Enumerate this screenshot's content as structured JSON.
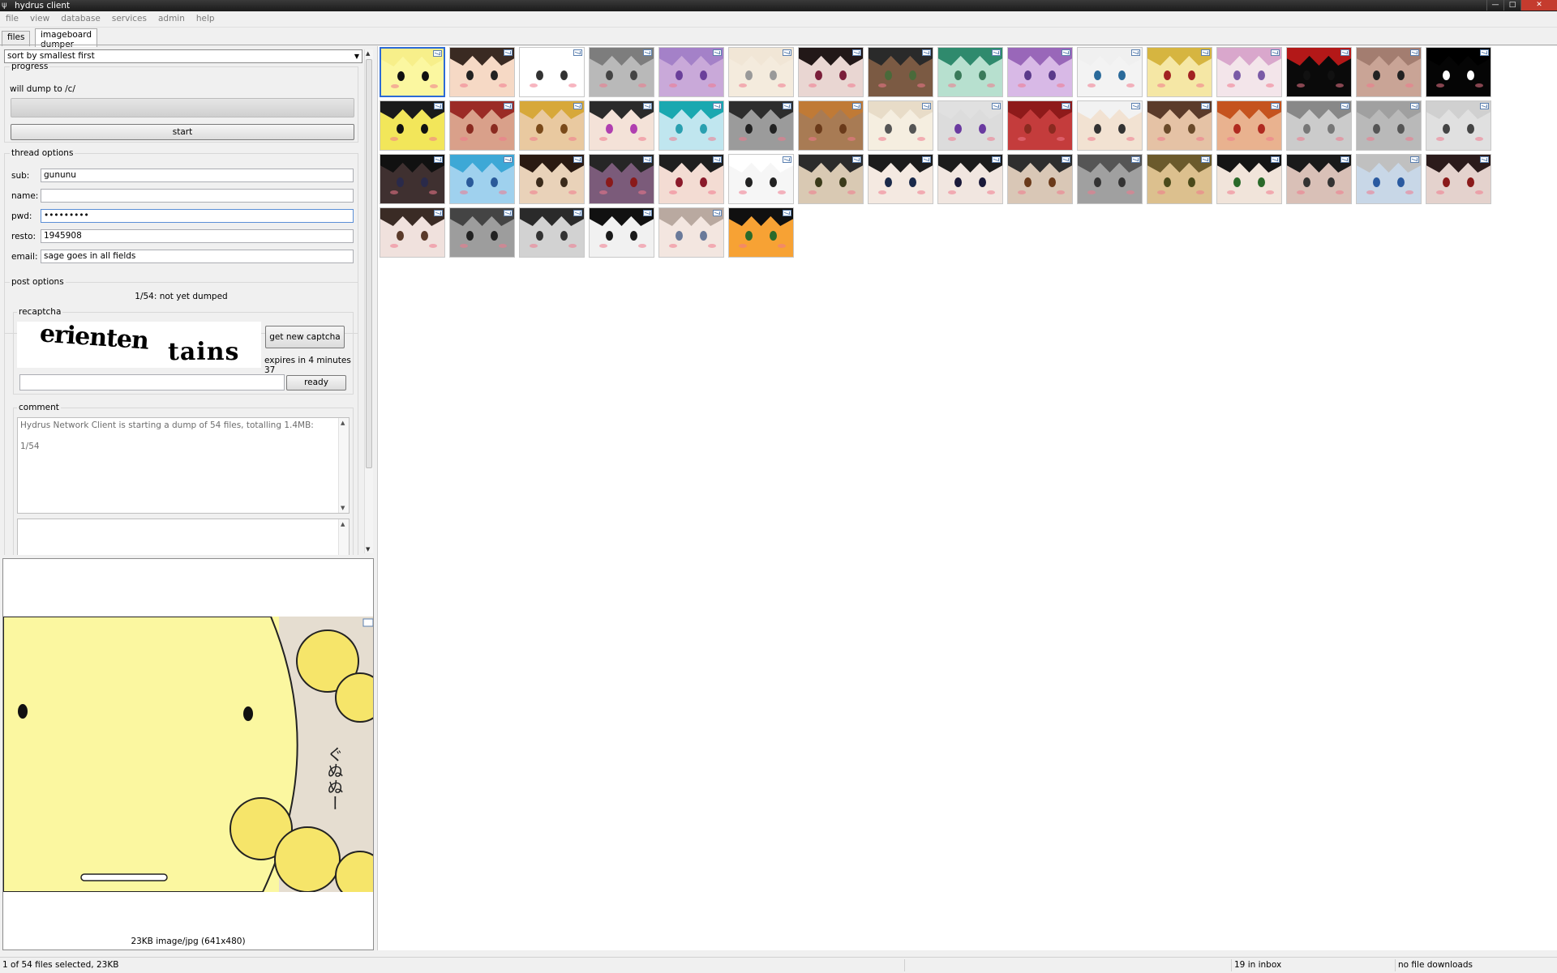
{
  "window": {
    "title": "hydrus client"
  },
  "menu": [
    "file",
    "view",
    "database",
    "services",
    "admin",
    "help"
  ],
  "tabs": [
    {
      "label": "files",
      "active": false
    },
    {
      "label": "imageboard dumper",
      "active": true
    }
  ],
  "sort": {
    "selected": "sort by smallest first"
  },
  "progress": {
    "title": "progress",
    "dump_target": "will dump to /c/",
    "value": 0,
    "start_label": "start"
  },
  "thread_options": {
    "title": "thread options",
    "fields": [
      {
        "label": "sub:",
        "value": "gununu"
      },
      {
        "label": "name:",
        "value": ""
      },
      {
        "label": "pwd:",
        "value": "•••••••••"
      },
      {
        "label": "resto:",
        "value": "1945908"
      },
      {
        "label": "email:",
        "value": "sage goes in all fields"
      }
    ]
  },
  "post_options": {
    "title": "post options",
    "status": "1/54: not yet dumped",
    "recaptcha": {
      "title": "recaptcha",
      "word1": "erienten",
      "word2": "tains",
      "new_captcha_label": "get new captcha",
      "expires": "expires in 4 minutes 37",
      "ready_label": "ready",
      "answer": ""
    },
    "comment": {
      "title": "comment",
      "line1": "Hydrus Network Client is starting a dump of 54 files, totalling 1.4MB:",
      "line2": "1/54"
    }
  },
  "preview": {
    "caption": "23KB image/jpg (641x480)",
    "vertical_text": "ぐぬぬー"
  },
  "thumbnails": {
    "count": 54,
    "selected_index": 0,
    "colors": [
      "#fbf7a0",
      "#f6d9c5",
      "#ffffff",
      "#b9b9b9",
      "#c9a9d9",
      "#f4ebdd",
      "#e9d6d2",
      "#7b5a43",
      "#b7e0cf",
      "#d8b9e6",
      "#f3f3f3",
      "#f5e7a5",
      "#f3e5ea",
      "#0a0a0a",
      "#c9a496",
      "#050505",
      "#f2e65a",
      "#d9a08a",
      "#e9c9a0",
      "#f4e2d8",
      "#c0e6ef",
      "#9b9b9b",
      "#a87b54",
      "#f5eee0",
      "#dcdcdc",
      "#c43c3c",
      "#f2e2d2",
      "#e5c2a5",
      "#e9b28f",
      "#cbcbcb",
      "#b9b9b9",
      "#e0e0e0",
      "#3f3030",
      "#9fd1ee",
      "#e9d2b9",
      "#7b5b7a",
      "#f3dcd3",
      "#f6f6f6",
      "#d9c9b3",
      "#f4e9e1",
      "#f1e6e0",
      "#d9c7b6",
      "#a0a0a0",
      "#dcc08e",
      "#f1e4da",
      "#d9c0b7",
      "#c8d7e7",
      "#e4d2cd",
      "#f0e1dd",
      "#9d9d9d",
      "#d2d2d2",
      "#f1f1f1",
      "#f3e6e0",
      "#f7a234"
    ],
    "hair_colors": [
      "#f7ef8a",
      "#3a2a22",
      "#ffffff",
      "#7d7d7d",
      "#a481c8",
      "#f1e6d6",
      "#221818",
      "#2a2a2a",
      "#2f8a6d",
      "#9967b9",
      "#f0f0f0",
      "#d6b540",
      "#d9a7cc",
      "#b31818",
      "#a37d70",
      "#000000",
      "#1a1a1a",
      "#9b2b26",
      "#d7a83a",
      "#2b2b2b",
      "#1aa8b0",
      "#2d2d2d",
      "#c07a36",
      "#e8dcc8",
      "#e0e0e0",
      "#8e1a1a",
      "#f2f2f2",
      "#5b3b2a",
      "#c5531e",
      "#888888",
      "#a0a0a0",
      "#d0d0d0",
      "#111111",
      "#3da8d6",
      "#2a1a12",
      "#262626",
      "#1f1f1f",
      "#ffffff",
      "#2b2b2b",
      "#1c1c1c",
      "#1c1c1c",
      "#2e2e2e",
      "#555555",
      "#6b5a2c",
      "#151515",
      "#1a1a1a",
      "#c0c0c0",
      "#2b1b1b",
      "#3a2b25",
      "#444444",
      "#2a2a2a",
      "#111111",
      "#b9a9a0",
      "#101010"
    ],
    "eye_colors": [
      "#111111",
      "#222222",
      "#333333",
      "#444444",
      "#6a3f9a",
      "#999999",
      "#7a1e3a",
      "#4a6a3a",
      "#3a7a5a",
      "#5a3a8a",
      "#2a6a9a",
      "#a22222",
      "#7a5aa6",
      "#111111",
      "#222222",
      "#ffffff",
      "#111111",
      "#8a2a20",
      "#7a4a1a",
      "#b03fb0",
      "#2aa0b0",
      "#222222",
      "#6a3a1a",
      "#555555",
      "#6a3aa0",
      "#8a2a20",
      "#333333",
      "#6a4a2a",
      "#b02a20",
      "#777777",
      "#555555",
      "#444444",
      "#2a2a4a",
      "#2a5a9a",
      "#3a2a1a",
      "#8a1a1a",
      "#8a1a2a",
      "#222222",
      "#3a3a1a",
      "#1a2a4a",
      "#1a1a3a",
      "#6a3a1a",
      "#333333",
      "#4a4a1a",
      "#2a6a2a",
      "#333333",
      "#2a5aa0",
      "#8a1a1a",
      "#5a3a2a",
      "#222222",
      "#333333",
      "#1a1a1a",
      "#6a7a9a",
      "#2a6a2a"
    ]
  },
  "status": {
    "selection": "1 of 54 files selected, 23KB",
    "inbox": "19 in inbox",
    "downloads": "no file downloads"
  }
}
